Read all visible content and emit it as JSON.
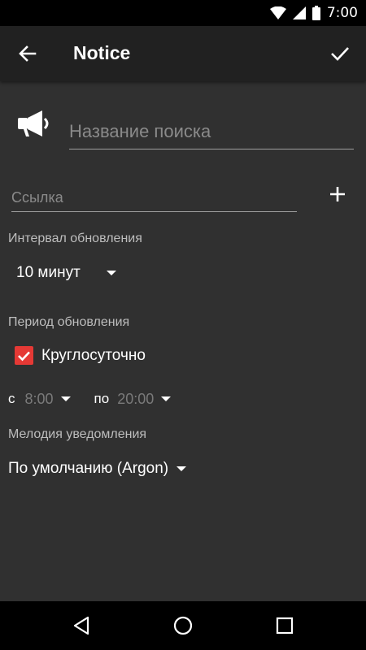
{
  "status_bar": {
    "time": "7:00"
  },
  "app_bar": {
    "title": "Notice"
  },
  "form": {
    "name_placeholder": "Название поиска",
    "link_placeholder": "Ссылка",
    "interval_label": "Интервал обновления",
    "interval_value": "10 минут",
    "period_label": "Период обновления",
    "around_clock_label": "Круглосуточно",
    "around_clock_checked": true,
    "from_prefix": "с",
    "from_value": "8:00",
    "to_prefix": "по",
    "to_value": "20:00",
    "melody_label": "Мелодия уведомления",
    "melody_value": "По умолчанию (Argon)"
  },
  "colors": {
    "accent": "#e53935",
    "background": "#303030",
    "toolbar": "#212121"
  }
}
